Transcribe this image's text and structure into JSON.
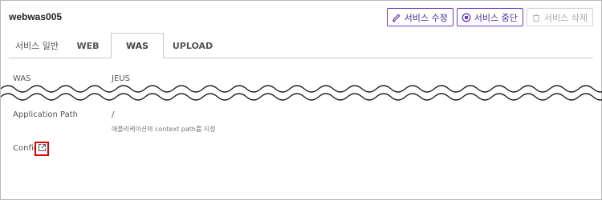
{
  "service": {
    "name": "webwas005"
  },
  "toolbar": {
    "edit_label": "서비스 수정",
    "stop_label": "서비스 중단",
    "delete_label": "서비스 삭제"
  },
  "tabs": [
    {
      "label": "서비스 일반"
    },
    {
      "label": "WEB"
    },
    {
      "label": "WAS",
      "active": true
    },
    {
      "label": "UPLOAD"
    }
  ],
  "fields": {
    "was": {
      "label": "WAS",
      "value": "JEUS"
    },
    "app_path": {
      "label": "Application Path",
      "value": "/",
      "hint": "애플리케이션의 context path를 지정"
    },
    "config": {
      "label": "Config"
    }
  },
  "icons": {
    "edit": "pencil-icon",
    "stop": "stop-circle-icon",
    "delete": "trash-icon",
    "config": "external-link-icon"
  },
  "colors": {
    "accent": "#6e3dbd",
    "highlight": "#e00000",
    "disabled": "#a9a9a9"
  }
}
